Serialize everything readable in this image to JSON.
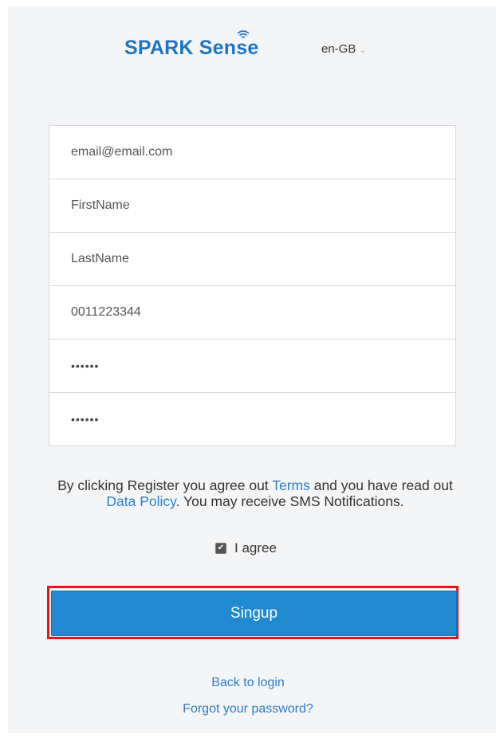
{
  "header": {
    "logo_part1": "SPARK Sen",
    "logo_wifi_letter": "s",
    "logo_part2": "e",
    "language": "en-GB"
  },
  "form": {
    "email": "email@email.com",
    "first_name": "FirstName",
    "last_name": "LastName",
    "phone": "0011223344",
    "password": "••••••",
    "confirm_password": "••••••"
  },
  "terms": {
    "text1": "By clicking Register you agree out ",
    "terms_link": "Terms",
    "text2": " and you have read out ",
    "policy_link": "Data Policy",
    "text3": ". You may receive SMS Notifications."
  },
  "agree_label": "I agree",
  "signup_label": "Singup",
  "back_to_login": "Back to login",
  "forgot_password": "Forgot your password?",
  "colors": {
    "brand": "#1e74c6",
    "button": "#2089d0",
    "highlight": "#e8141a"
  }
}
